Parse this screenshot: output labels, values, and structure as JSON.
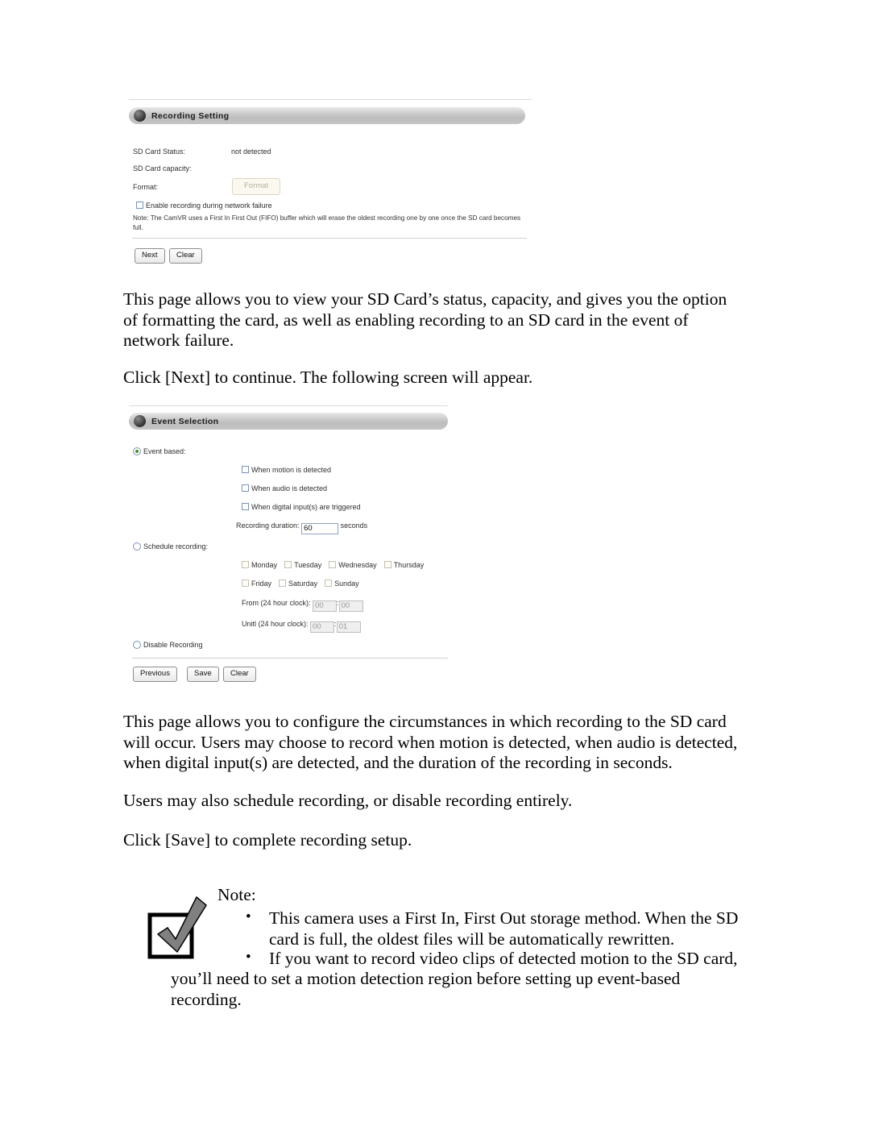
{
  "page": {
    "background": "#ffffff",
    "body_font_color": "#000000"
  },
  "panel_recording": {
    "header_title": "Recording Setting",
    "header_icon": "sphere-orb-icon",
    "fields": [
      {
        "label": "SD Card Status:",
        "value": "not detected"
      },
      {
        "label": "SD Card capacity:",
        "value": ""
      },
      {
        "label": "Format:",
        "value": ""
      }
    ],
    "format_button": {
      "label": "Format",
      "disabled": true
    },
    "enable_checkbox": {
      "label": "Enable recording during network failure",
      "checked": false
    },
    "note": "Note: The CamVR uses a First In First Out (FIFO) buffer which will erase the oldest recording one by one once the SD card becomes full.",
    "buttons": [
      {
        "label": "Next"
      },
      {
        "label": "Clear"
      }
    ]
  },
  "panel_event": {
    "header_title": "Event Selection",
    "header_icon": "sphere-orb-icon",
    "radio_event_based": {
      "label": "Event based:",
      "selected": true
    },
    "event_checkboxes": [
      {
        "label": "When motion is detected",
        "checked": false
      },
      {
        "label": "When audio is detected",
        "checked": false
      },
      {
        "label": "When digital input(s) are triggered",
        "checked": false
      }
    ],
    "duration": {
      "label": "Recording duration:",
      "value": "60",
      "unit": "seconds",
      "disabled": false
    },
    "radio_schedule": {
      "label": "Schedule recording:",
      "selected": false
    },
    "day_checkboxes_row1": [
      {
        "label": "Monday",
        "checked": false
      },
      {
        "label": "Tuesday",
        "checked": false
      },
      {
        "label": "Wednesday",
        "checked": false
      },
      {
        "label": "Thursday",
        "checked": false
      }
    ],
    "day_checkboxes_row2": [
      {
        "label": "Friday",
        "checked": false
      },
      {
        "label": "Saturday",
        "checked": false
      },
      {
        "label": "Sunday",
        "checked": false
      }
    ],
    "time_from": {
      "label": "From (24 hour clock):",
      "hour": "00",
      "minute": "00",
      "separator": ":",
      "disabled": true
    },
    "time_until": {
      "label": "Unitl (24 hour clock):",
      "hour": "00",
      "minute": "01",
      "separator": ":",
      "disabled": true
    },
    "radio_disable": {
      "label": "Disable Recording",
      "selected": false
    },
    "buttons": [
      {
        "label": "Previous"
      },
      {
        "label": "Save"
      },
      {
        "label": "Clear"
      }
    ]
  },
  "body_text": {
    "para1_line1": "This page allows you to view your SD Card’s status, capacity, and gives you the option",
    "para1_line2": "of formatting the card, as well as enabling recording to an SD card in the event of",
    "para1_line3": "network failure.",
    "para2": "Click [Next] to continue. The following screen will appear.",
    "para3_line1": "This page allows you to configure the circumstances in which recording to the SD card",
    "para3_line2": "will occur. Users may choose to record when motion is detected, when audio is detected,",
    "para3_line3": "when digital input(s) are detected, and the duration of the recording in seconds.",
    "para4": "Users may also schedule recording, or disable recording entirely.",
    "para5": "Click [Save] to complete recording setup."
  },
  "note_block": {
    "icon": "checkmark-in-box-icon",
    "heading": "Note:",
    "bullet_symbol": "•",
    "bullet1_line1": "This camera uses a First In, First Out storage method. When the SD",
    "bullet1_line2": "card is full, the oldest files will be automatically rewritten.",
    "bullet2_line1": "If you want to record video clips of detected motion to the SD card,",
    "bullet2_line2": "you’ll need to set a motion detection region before setting up event-based",
    "bullet2_line3": "recording."
  }
}
